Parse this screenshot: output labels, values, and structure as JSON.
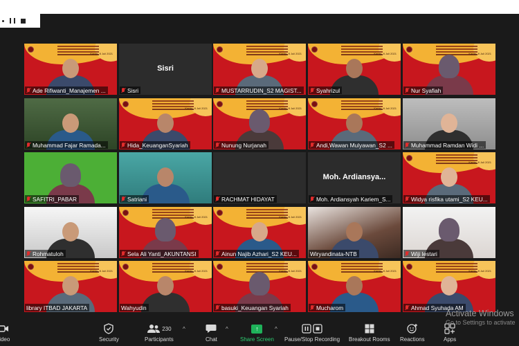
{
  "window": {
    "app": "Zoom Meeting"
  },
  "recording_controls": {
    "pause_icon": "pause-icon",
    "stop_icon": "stop-icon"
  },
  "participants": [
    {
      "name": "Ade Rifiwanti_Manajemen ...",
      "muted": true,
      "tile": "slide",
      "date": "Kamis, 8 Juli 2021"
    },
    {
      "name": "Sisri",
      "muted": true,
      "tile": "plain",
      "center_name": "Sisri"
    },
    {
      "name": "MUSTARRUDIN_S2 MAGIST...",
      "muted": true,
      "tile": "slide",
      "date": "Kamis, 8 Juli 2021"
    },
    {
      "name": "Syahrizul",
      "muted": true,
      "tile": "slide",
      "date": "Kamis, 8 Juli 2021"
    },
    {
      "name": "Nur Syafiah",
      "muted": true,
      "tile": "slide",
      "date": "Kamis, 8 Juli 2021"
    },
    {
      "name": "Muhammad Fajar Ramada...",
      "muted": true,
      "tile": "tree"
    },
    {
      "name": "Hida_KeuanganSyariah",
      "muted": true,
      "tile": "slide",
      "date": "Kamis, 8 Juli 2021"
    },
    {
      "name": "Nunung Nurjanah",
      "muted": true,
      "tile": "slide",
      "date": "Kamis, 8 Juli 2021"
    },
    {
      "name": "Andi,Wawan Mulyawan_S2 ...",
      "muted": true,
      "tile": "slide",
      "date": "Kamis, 8 Juli 2021"
    },
    {
      "name": "Muhammad Ramdan Widi ...",
      "muted": true,
      "tile": "cam"
    },
    {
      "name": "SAFITRI_PABAR",
      "muted": true,
      "tile": "green"
    },
    {
      "name": "Satriani",
      "muted": true,
      "tile": "teal"
    },
    {
      "name": "RACHMAT HIDAYAT",
      "muted": true,
      "tile": "plain"
    },
    {
      "name": "Moh. Ardiansyah Kariem_S...",
      "muted": true,
      "tile": "plain",
      "center_name": "Moh. Ardiansya..."
    },
    {
      "name": "Widya risfika utami_S2 KEU...",
      "muted": true,
      "tile": "slide",
      "date": "Kamis, 8 Juli 2021"
    },
    {
      "name": "Rohmatuloh",
      "muted": true,
      "tile": "office"
    },
    {
      "name": "Sela Ali Yanti_AKUNTANSI",
      "muted": true,
      "tile": "slide",
      "date": "Kamis, 8 Juli 2021"
    },
    {
      "name": "Ainun Najib Azhari_S2 KEU...",
      "muted": true,
      "tile": "slide",
      "date": "Kamis, 8 Juli 2021"
    },
    {
      "name": "Wiryandinata-NTB",
      "muted": false,
      "tile": "blur"
    },
    {
      "name": "Wiji lestari",
      "muted": true,
      "tile": "pink"
    },
    {
      "name": "library ITBAD JAKARTA",
      "muted": false,
      "tile": "slide",
      "date": "Kamis, 8 Juli 2021",
      "active_speaker": true
    },
    {
      "name": "Wahyudin",
      "muted": false,
      "tile": "slide",
      "date": "Kamis, 8 Juli 2021"
    },
    {
      "name": "basuki_Keuangan Syariah",
      "muted": true,
      "tile": "slide",
      "date": "Kamis, 8 Juli 2021"
    },
    {
      "name": "Mucharom",
      "muted": true,
      "tile": "slide",
      "date": "Kamis, 8 Juli 2021"
    },
    {
      "name": "Ahmad Syuhada AM",
      "muted": true,
      "tile": "slide",
      "date": "Kamis, 8 Juli 2021"
    }
  ],
  "toolbar": {
    "video_label": "Video",
    "security_label": "Security",
    "participants_label": "Participants",
    "participants_count": "230",
    "chat_label": "Chat",
    "share_label": "Share Screen",
    "record_label": "Pause/Stop Recording",
    "breakout_label": "Breakout Rooms",
    "reactions_label": "Reactions",
    "apps_label": "Apps"
  },
  "windows_watermark": {
    "title": "Activate Windows",
    "subtitle": "Go to Settings to activate"
  },
  "colors": {
    "slide_red": "#c8171e",
    "slide_yellow": "#f3b234",
    "active_border": "#f5d319",
    "share_green": "#1fb25a",
    "mute_red": "#e02c2c"
  }
}
